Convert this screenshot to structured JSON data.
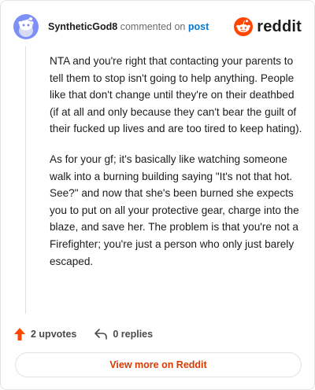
{
  "header": {
    "author": "SyntheticGod8",
    "verb": "commented on",
    "post_link": "post",
    "logo_text": "reddit"
  },
  "comment": {
    "paragraphs": [
      "NTA and you're right that contacting your parents to tell them to stop isn't going to help anything. People like that don't change until they're on their deathbed (if at all and only because they can't bear the guilt of their fucked up lives and are too tired to keep hating).",
      "As for your gf; it's basically like watching someone walk into a burning building saying \"It's not that hot. See?\" and now that she's been burned she expects you to put on all your protective gear, charge into the blaze, and save her. The problem is that you're not a Firefighter; you're just a person who only just barely escaped."
    ]
  },
  "footer": {
    "upvotes": "2 upvotes",
    "replies": "0 replies"
  },
  "button": {
    "label": "View more on Reddit"
  },
  "colors": {
    "accent": "#d93a00",
    "upvote": "#ff4500",
    "link": "#0079d3",
    "avatar_bg": "#7e8ff7"
  },
  "icons": {
    "avatar": "snoo-avatar-icon",
    "logo": "reddit-snoo-icon",
    "upvote": "upvote-arrow-icon",
    "reply": "reply-arrow-icon"
  }
}
